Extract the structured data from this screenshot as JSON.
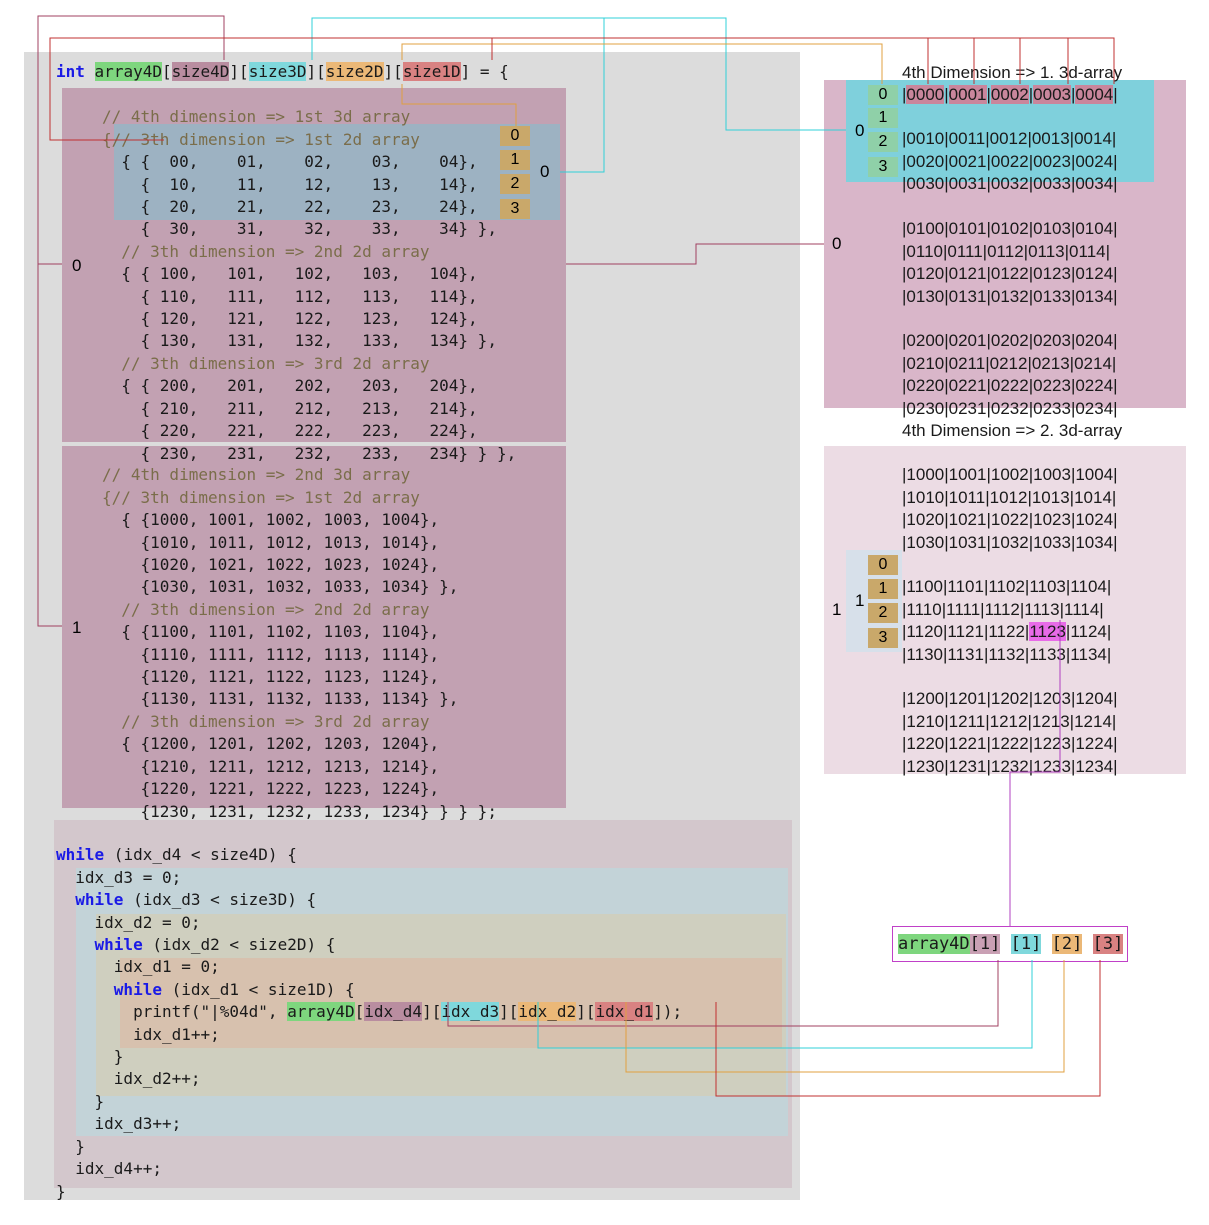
{
  "decl": {
    "type_kw": "int",
    "array_name": "array4D",
    "size4": "size4D",
    "size3": "size3D",
    "size2": "size2D",
    "size1": "size1D",
    "suffix": " = {"
  },
  "block0": {
    "lines": [
      "// 4th dimension => 1st 3d array",
      "{// 3th dimension => 1st 2d array",
      "  { {  00,    01,    02,    03,    04},",
      "    {  10,    11,    12,    13,    14},",
      "    {  20,    21,    22,    23,    24},",
      "    {  30,    31,    32,    33,    34} },",
      "  // 3th dimension => 2nd 2d array",
      "  { { 100,   101,   102,   103,   104},",
      "    { 110,   111,   112,   113,   114},",
      "    { 120,   121,   122,   123,   124},",
      "    { 130,   131,   132,   133,   134} },",
      "  // 3th dimension => 3rd 2d array",
      "  { { 200,   201,   202,   203,   204},",
      "    { 210,   211,   212,   213,   214},",
      "    { 220,   221,   222,   223,   224},",
      "    { 230,   231,   232,   233,   234} } },"
    ],
    "index": "0"
  },
  "block1": {
    "lines": [
      "// 4th dimension => 2nd 3d array",
      "{// 3th dimension => 1st 2d array",
      "  { {1000, 1001, 1002, 1003, 1004},",
      "    {1010, 1011, 1012, 1013, 1014},",
      "    {1020, 1021, 1022, 1023, 1024},",
      "    {1030, 1031, 1032, 1033, 1034} },",
      "  // 3th dimension => 2nd 2d array",
      "  { {1100, 1101, 1102, 1103, 1104},",
      "    {1110, 1111, 1112, 1113, 1114},",
      "    {1120, 1121, 1122, 1123, 1124},",
      "    {1130, 1131, 1132, 1133, 1134} },",
      "  // 3th dimension => 3rd 2d array",
      "  { {1200, 1201, 1202, 1203, 1204},",
      "    {1210, 1211, 1212, 1213, 1214},",
      "    {1220, 1221, 1222, 1223, 1224},",
      "    {1230, 1231, 1232, 1233, 1234} } } };"
    ],
    "index": "1"
  },
  "inner_row_indices": [
    "0",
    "1",
    "2",
    "3"
  ],
  "inner_block_index": "0",
  "loop": {
    "while_kw": "while",
    "l1": " (idx_d4 < size4D) {",
    "l2": "  idx_d3 = 0;",
    "l3": " (idx_d3 < size3D) {",
    "l4": "    idx_d2 = 0;",
    "l5": " (idx_d2 < size2D) {",
    "l6": "      idx_d1 = 0;",
    "l7": " (idx_d1 < size1D) {",
    "l8_pre": "        printf(\"|%04d\", ",
    "l8_arr": "array4D",
    "l8_i4": "idx_d4",
    "l8_i3": "idx_d3",
    "l8_i2": "idx_d2",
    "l8_i1": "idx_d1",
    "l8_post": ");",
    "l9": "        idx_d1++;",
    "l10": "      }",
    "l11": "      idx_d2++;",
    "l12": "    }",
    "l13": "    idx_d3++;",
    "l14": "  }",
    "l15": "  idx_d4++;",
    "l16": "}"
  },
  "right1": {
    "title": "4th Dimension => 1. 3d-array",
    "first_row_cells": [
      "0000",
      "0001",
      "0002",
      "0003",
      "0004"
    ],
    "rows_block0": [
      "|0010|0011|0012|0013|0014|",
      "|0020|0021|0022|0023|0024|",
      "|0030|0031|0032|0033|0034|"
    ],
    "rows_block1": [
      "|0100|0101|0102|0103|0104|",
      "|0110|0111|0112|0113|0114|",
      "|0120|0121|0122|0123|0124|",
      "|0130|0131|0132|0133|0134|"
    ],
    "rows_block2": [
      "|0200|0201|0202|0203|0204|",
      "|0210|0211|0212|0213|0214|",
      "|0220|0221|0222|0223|0224|",
      "|0230|0231|0232|0233|0234|"
    ],
    "row_indices": [
      "0",
      "1",
      "2",
      "3"
    ],
    "block_index": "0",
    "outer_index": "0"
  },
  "right2": {
    "title": "4th Dimension => 2. 3d-array",
    "rows_block0": [
      "|1000|1001|1002|1003|1004|",
      "|1010|1011|1012|1013|1014|",
      "|1020|1021|1022|1023|1024|",
      "|1030|1031|1032|1033|1034|"
    ],
    "rows_block1_a": "|1100|1101|1102|1103|1104|",
    "rows_block1_b": "|1110|1111|1112|1113|1114|",
    "rows_block1_c_pre": "|1120|1121|1122|",
    "rows_block1_c_hl": "1123",
    "rows_block1_c_post": "|1124|",
    "rows_block1_d": "|1130|1131|1132|1133|1134|",
    "rows_block2": [
      "|1200|1201|1202|1203|1204|",
      "|1210|1211|1212|1213|1214|",
      "|1220|1221|1222|1223|1224|",
      "|1230|1231|1232|1233|1234|"
    ],
    "row_indices": [
      "0",
      "1",
      "2",
      "3"
    ],
    "block_index": "1",
    "outer_index": "1"
  },
  "example": {
    "name": "array4D",
    "i4": "1",
    "i3": "1",
    "i2": "2",
    "i1": "3"
  },
  "colors": {
    "green": "#7ed67e",
    "mauve": "#b98da0",
    "cyan": "#7fd8dc",
    "orange": "#ebb877",
    "red": "#d98282",
    "magenta": "#e86be8",
    "line_red": "#c03030",
    "line_cyan": "#30d0d8",
    "line_orange": "#e0a040",
    "line_maroon": "#a04060",
    "line_purple": "#b040c0"
  }
}
